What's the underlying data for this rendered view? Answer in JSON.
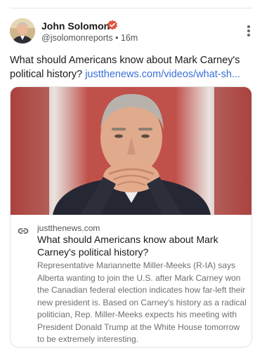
{
  "post": {
    "author_name": "John Solomon",
    "handle": "@jsolomonreports",
    "separator": "•",
    "time": "16m",
    "text": "What should Americans know about Mark Carney's political history?",
    "link_text": "justthenews.com/videos/what-sh..."
  },
  "card": {
    "domain": "justthenews.com",
    "title": "What should Americans know about Mark Carney's political history?",
    "description": "Representative Mariannette Miller-Meeks (R-IA) says Alberta wanting to join the U.S. after Mark Carney won the Canadian federal election indicates how far-left their new president is. Based on Carney's history as a radical politician, Rep. Miller-Meeks expects his meeting with President Donald Trump at the White House tomorrow to be extremely interesting."
  },
  "colors": {
    "link": "#3a6fd8",
    "verified_badge": "#e0533c"
  },
  "icons": {
    "verified": "verified-badge-icon",
    "menu": "more-vertical-icon",
    "link": "link-chain-icon"
  }
}
